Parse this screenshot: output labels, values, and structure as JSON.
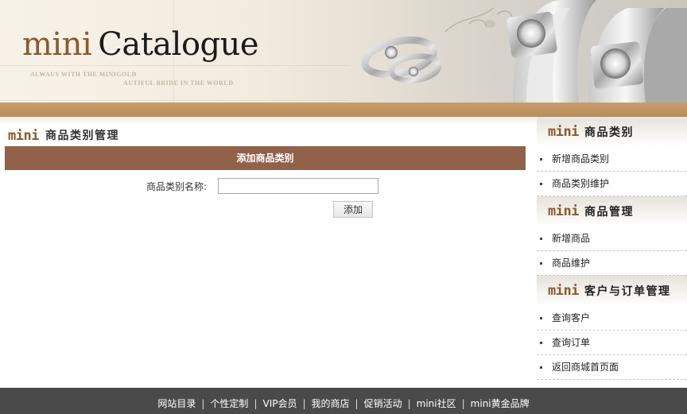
{
  "banner": {
    "brand_mini": "mini",
    "brand_catalogue": "Catalogue",
    "slogan_line1": "ALWAUS WITH THE MINIGOLD",
    "slogan_line2": "AUTIFUL BRIDE IN THE WORLD"
  },
  "main": {
    "heading_mini": "mini",
    "heading": "商品类别管理",
    "form": {
      "title": "添加商品类别",
      "name_label": "商品类别名称:",
      "name_value": "",
      "submit_label": "添加"
    }
  },
  "sidebar": {
    "sections": [
      {
        "mini": "mini",
        "title": "商品类别",
        "items": [
          "新增商品类别",
          "商品类别维护"
        ]
      },
      {
        "mini": "mini",
        "title": "商品管理",
        "items": [
          "新增商品",
          "商品维护"
        ]
      },
      {
        "mini": "mini",
        "title": "客户与订单管理",
        "items": [
          "查询客户",
          "查询订单",
          "返回商城首页面"
        ]
      }
    ]
  },
  "footer": {
    "links": [
      "网站目录",
      "个性定制",
      "VIP会员",
      "我的商店",
      "促销活动",
      "mini社区",
      "mini黄金品牌"
    ]
  },
  "colors": {
    "brand_brown": "#8a5a2e",
    "form_title_bg": "#91614a",
    "footer_bg": "#4a4a4a",
    "band_brown": "#c79e6d"
  }
}
